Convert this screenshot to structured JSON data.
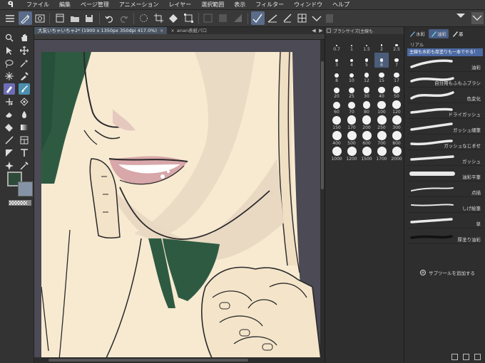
{
  "menubar": {
    "logo": "ᑫ",
    "items": [
      "ファイル",
      "編集",
      "ページ管理",
      "アニメーション",
      "レイヤー",
      "選択範囲",
      "表示",
      "フィルター",
      "ウィンドウ",
      "ヘルプ"
    ]
  },
  "tabs": [
    {
      "label": "大友いちゃいちゃ2* (1900 x 1350px 350dpi 417.0%)",
      "close": "×",
      "active": true
    },
    {
      "label": "anan表紙パロ",
      "close": "×",
      "active": false
    }
  ],
  "tab_nav": {
    "prev": "◀",
    "next": "▶"
  },
  "brush_size": {
    "header": "ブラシサイズ[主線も",
    "values": [
      "0.7",
      "1",
      "1.5",
      "2",
      "2.5",
      "3",
      "4",
      "5",
      "6",
      "7",
      "8",
      "10",
      "12",
      "15",
      "17",
      "20",
      "25",
      "30",
      "40",
      "50",
      "60",
      "70",
      "80",
      "100",
      "120",
      "150",
      "170",
      "200",
      "250",
      "300",
      "400",
      "500",
      "600",
      "700",
      "800",
      "1000",
      "1200",
      "1500",
      "1700",
      "2000"
    ],
    "selected_index": 8
  },
  "subtool": {
    "tabs": [
      {
        "label": "水彩",
        "active": false
      },
      {
        "label": "油彩",
        "active": true
      },
      {
        "label": "墨",
        "active": false
      }
    ],
    "group_label": "リアル",
    "selected": "主線も水彩も厚塗りも一本でやる！",
    "items": [
      "油彩",
      "自分用もふもふブラシ",
      "色変化",
      "ドライガッシュ",
      "ガッシュ細筆",
      "ガッシュなじませ",
      "ガッシュ",
      "油彩平筆",
      "点描",
      "しげ絵筆",
      "草",
      "厚塗り油彩"
    ],
    "add_label": "サブツールを追加する"
  },
  "colors": {
    "main": "#2e4b3a",
    "sub": "#8593a6",
    "accent": "#4c6aa3"
  }
}
